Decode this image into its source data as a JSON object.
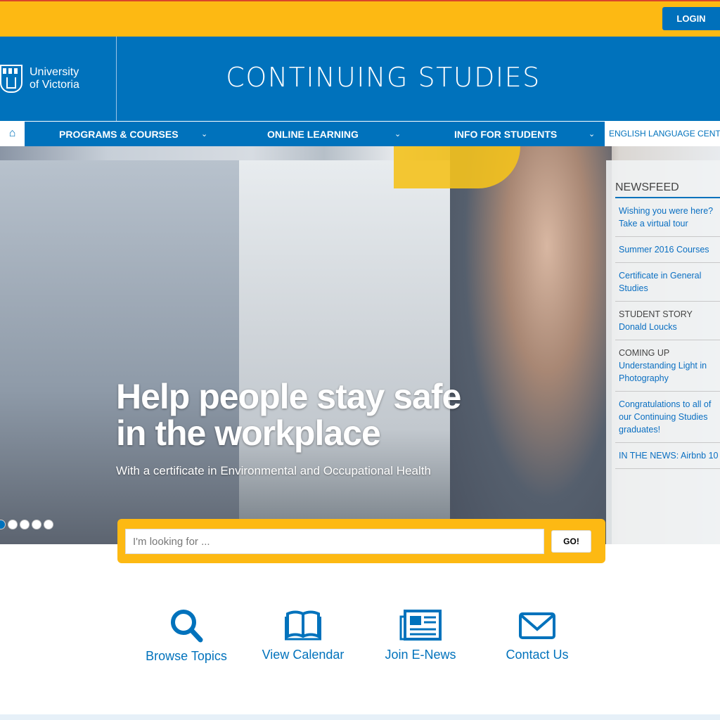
{
  "topbar": {
    "login": "LOGIN"
  },
  "header": {
    "logo_line1": "University",
    "logo_line2": "of Victoria",
    "title": "CONTINUING STUDIES"
  },
  "nav": {
    "items": [
      {
        "label": "PROGRAMS & COURSES"
      },
      {
        "label": "ONLINE LEARNING"
      },
      {
        "label": "INFO FOR STUDENTS"
      }
    ],
    "english": "ENGLISH LANGUAGE CENT"
  },
  "hero": {
    "headline_line1": "Help people stay safe",
    "headline_line2": "in the workplace",
    "subtitle": "With a certificate in Environmental and Occupational Health",
    "slides": 5,
    "active_slide": 1
  },
  "newsfeed": {
    "title": "NEWSFEED",
    "items": [
      {
        "label": "",
        "text": "Wishing you were here? Take a virtual tour"
      },
      {
        "label": "",
        "text": "Summer 2016 Courses"
      },
      {
        "label": "",
        "text": "Certificate in General Studies"
      },
      {
        "label": "STUDENT STORY",
        "text": "Donald Loucks"
      },
      {
        "label": "COMING UP",
        "text": "Understanding Light in Photography"
      },
      {
        "label": "",
        "text": "Congratulations to all of our Continuing Studies graduates!"
      },
      {
        "label": "",
        "text": "IN THE NEWS: Airbnb 10"
      }
    ]
  },
  "search": {
    "placeholder": "I'm looking for ...",
    "button": "GO!"
  },
  "quicklinks": [
    {
      "label": "Browse Topics",
      "icon": "search-icon"
    },
    {
      "label": "View Calendar",
      "icon": "book-icon"
    },
    {
      "label": "Join E-News",
      "icon": "newspaper-icon"
    },
    {
      "label": "Contact Us",
      "icon": "envelope-icon"
    }
  ],
  "colors": {
    "brand_blue": "#0072bc",
    "brand_gold": "#fdb913"
  }
}
